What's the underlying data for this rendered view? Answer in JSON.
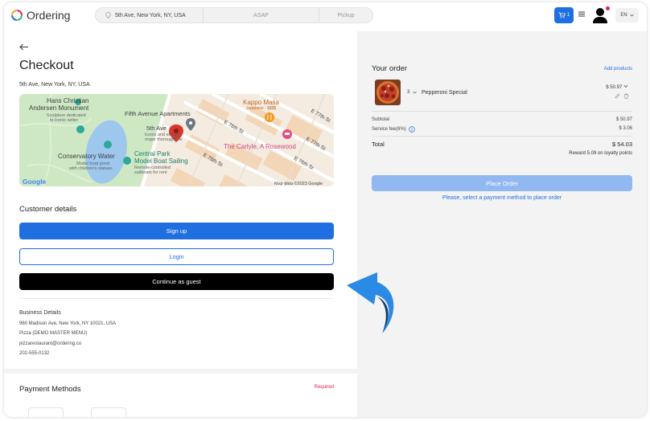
{
  "header": {
    "logo_text": "Ordering",
    "address": "5th Ave, New York, NY, USA",
    "time": "ASAP",
    "order_type": "Pickup",
    "cart_count": "1",
    "language": "EN"
  },
  "checkout": {
    "title": "Checkout",
    "address": "5th Ave, New York, NY, USA",
    "map_labels": {
      "label_1": "Hans Christian",
      "label_2": "Andersen Monument",
      "label_3": "Sculpture dedicated",
      "label_4": "to iconic writer",
      "label_5": "Fifth Avenue Apartments",
      "label_6": "Kappo Masa",
      "label_7": "Japanese · $$$$",
      "label_8": "5th Ave",
      "label_9": "Iconic and elegant",
      "label_10": "major thoroughfare",
      "label_11": "Conservatory Water",
      "label_12": "Model boat pond",
      "label_13": "with children's statues",
      "label_14": "Central Park",
      "label_15": "Model Boat Sailing",
      "label_16": "Remote-controlled",
      "label_17": "sailboats for rent",
      "label_18": "The Carlyle, A Rosewood",
      "label_19": "E 76th St",
      "label_20": "E 77th St",
      "label_21": "E 75th St",
      "label_22": "E 76th St",
      "label_23": "E 77th St",
      "google": "Google",
      "map_data": "Map data ©2023 Google"
    }
  },
  "customer": {
    "title": "Customer details",
    "signup_label": "Sign up",
    "login_label": "Login",
    "guest_label": "Continue as guest"
  },
  "business": {
    "heading": "Business Details",
    "address": "960 Madison Ave, New York, NY 10021, USA",
    "name": "Pizza (DEMO MASTER MENU)",
    "email": "pizzarestaurant@ordering.co",
    "phone": "202-555-0132"
  },
  "payment": {
    "title": "Payment Methods",
    "required": "Required"
  },
  "order": {
    "title": "Your order",
    "add_products": "Add products",
    "item": {
      "qty": "3",
      "name": "Pepperoni Special",
      "price": "$ 50.97"
    },
    "subtotal_label": "Subtotal",
    "subtotal_value": "$ 50.97",
    "service_fee_label": "Service fee(6%)",
    "service_fee_value": "$ 3.06",
    "total_label": "Total",
    "total_value": "$ 54.03",
    "reward": "Reward 5.09 on loyalty points",
    "place_order": "Place Order",
    "warning": "Please, select a payment method to place order"
  },
  "colors": {
    "primary": "#1f6fe0",
    "disabled": "#91b8f0",
    "danger": "#e5234a"
  }
}
